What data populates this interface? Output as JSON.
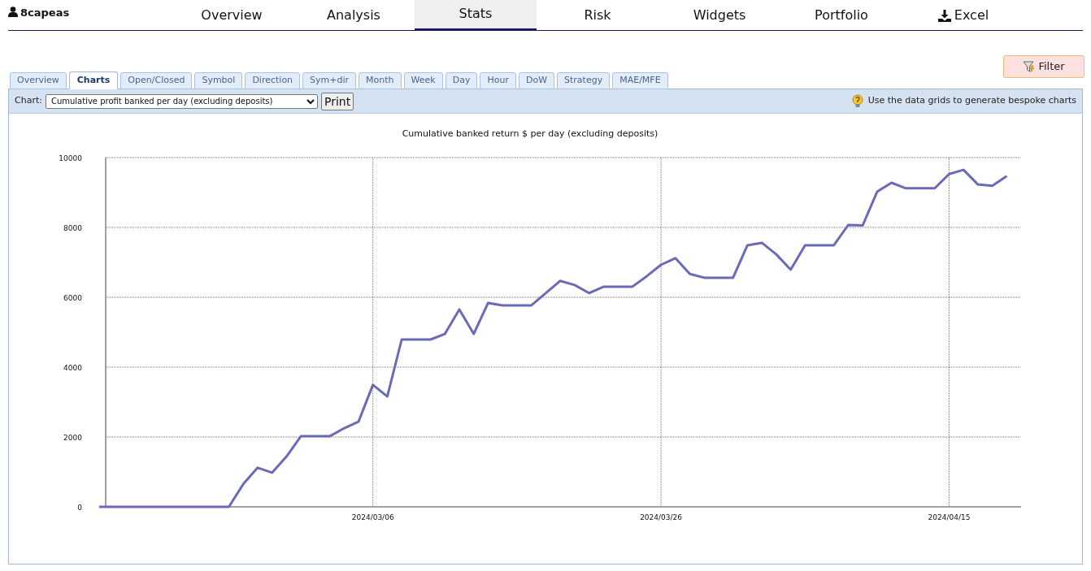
{
  "user": {
    "name": "8capeas"
  },
  "nav": [
    {
      "label": "Overview",
      "selected": false,
      "kind": "link"
    },
    {
      "label": "Analysis",
      "selected": false,
      "kind": "link"
    },
    {
      "label": "Stats",
      "selected": true,
      "kind": "link"
    },
    {
      "label": "Risk",
      "selected": false,
      "kind": "link"
    },
    {
      "label": "Widgets",
      "selected": false,
      "kind": "link"
    },
    {
      "label": "Portfolio",
      "selected": false,
      "kind": "link"
    },
    {
      "label": "Excel",
      "selected": false,
      "kind": "download"
    }
  ],
  "filter_button": {
    "label": "Filter"
  },
  "tabs": [
    {
      "label": "Overview",
      "selected": false
    },
    {
      "label": "Charts",
      "selected": true
    },
    {
      "label": "Open/Closed",
      "selected": false
    },
    {
      "label": "Symbol",
      "selected": false
    },
    {
      "label": "Direction",
      "selected": false
    },
    {
      "label": "Sym+dir",
      "selected": false
    },
    {
      "label": "Month",
      "selected": false
    },
    {
      "label": "Week",
      "selected": false
    },
    {
      "label": "Day",
      "selected": false
    },
    {
      "label": "Hour",
      "selected": false
    },
    {
      "label": "DoW",
      "selected": false
    },
    {
      "label": "Strategy",
      "selected": false
    },
    {
      "label": "MAE/MFE",
      "selected": false
    }
  ],
  "toolbar": {
    "chart_label": "Chart:",
    "chart_select": {
      "value": "Cumulative profit banked per day (excluding deposits)"
    },
    "print_button": "Print",
    "hint": "Use the data grids to generate bespoke charts"
  },
  "chart": {
    "chart_data": {
      "type": "line",
      "title": "Cumulative banked return $ per day (excluding deposits)",
      "grid": true,
      "categories": [
        null,
        null,
        null,
        null,
        null,
        null,
        null,
        null,
        null,
        null,
        null,
        null,
        null,
        null,
        null,
        null,
        null,
        null,
        null,
        "2024/03/06",
        null,
        null,
        null,
        null,
        null,
        null,
        null,
        null,
        null,
        null,
        null,
        null,
        null,
        null,
        null,
        null,
        null,
        null,
        null,
        "2024/03/26",
        null,
        null,
        null,
        null,
        null,
        null,
        null,
        null,
        null,
        null,
        null,
        null,
        null,
        null,
        null,
        null,
        null,
        null,
        null,
        "2024/04/15",
        null,
        null,
        null,
        null
      ],
      "values": [
        0,
        0,
        0,
        0,
        0,
        0,
        0,
        0,
        0,
        0,
        650,
        1120,
        980,
        1440,
        2020,
        2020,
        2020,
        2250,
        2440,
        3490,
        3160,
        4790,
        4790,
        4790,
        4950,
        5650,
        4950,
        5840,
        5770,
        5770,
        5770,
        6120,
        6470,
        6350,
        6120,
        6300,
        6300,
        6300,
        6600,
        6930,
        7120,
        6670,
        6560,
        6560,
        6560,
        7490,
        7560,
        7230,
        6790,
        7490,
        7490,
        7490,
        8070,
        8060,
        9020,
        9280,
        9120,
        9120,
        9120,
        9530,
        9650,
        9230,
        9190,
        9470
      ],
      "ylim": [
        0,
        10000
      ],
      "yticks": [
        0,
        2000,
        4000,
        6000,
        8000,
        10000
      ]
    }
  }
}
